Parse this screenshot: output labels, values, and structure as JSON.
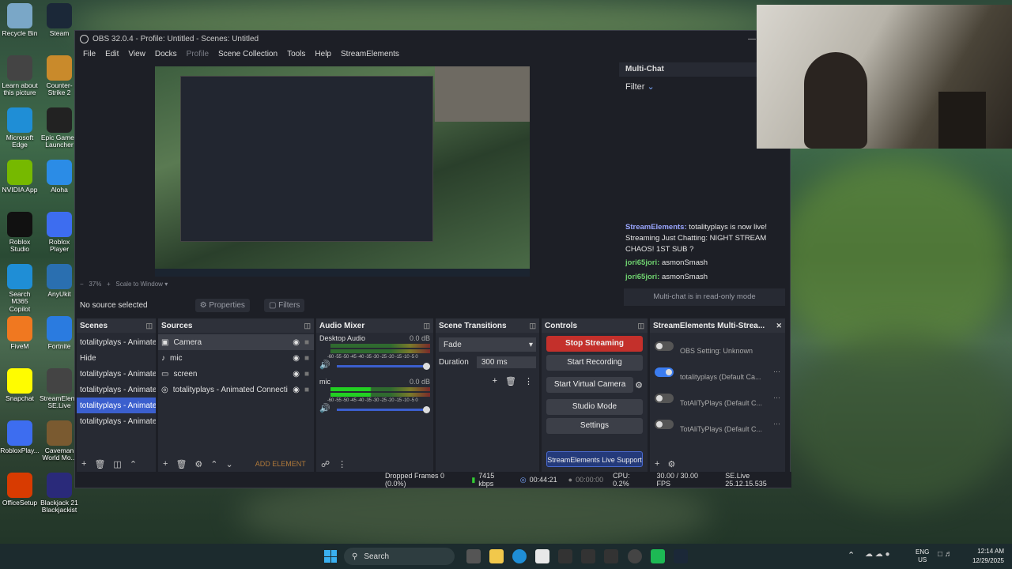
{
  "desktop": {
    "icons": [
      {
        "label": "Recycle Bin",
        "color": "#7aa7c7"
      },
      {
        "label": "Steam",
        "color": "#1b2838"
      },
      {
        "label": "",
        "color": "#ea4335"
      },
      {
        "label": "Learn about this picture",
        "color": "#444"
      },
      {
        "label": "Counter-Strike 2",
        "color": "#c98a2b"
      },
      {
        "label": "Microsoft Edge",
        "color": "#1f8ed6"
      },
      {
        "label": "Epic Games Launcher",
        "color": "#222"
      },
      {
        "label": "NVIDIA App",
        "color": "#76b900"
      },
      {
        "label": "Aloha",
        "color": "#2b8ce6"
      },
      {
        "label": "Roblox Studio",
        "color": "#111"
      },
      {
        "label": "Roblox Player",
        "color": "#3d6df0"
      },
      {
        "label": "Search M365 Copilot",
        "color": "#1f8ed6"
      },
      {
        "label": "AnyUkit",
        "color": "#2a6fb0"
      },
      {
        "label": "FiveM",
        "color": "#f07820"
      },
      {
        "label": "Fortnite",
        "color": "#2a7be0"
      },
      {
        "label": "Snapchat",
        "color": "#fffc00"
      },
      {
        "label": "StreamElements SE.Live",
        "color": "#444"
      },
      {
        "label": "RobloxPlay...",
        "color": "#3d6df0"
      },
      {
        "label": "Caveman World Mo...",
        "color": "#7a5a30"
      },
      {
        "label": "OfficeSetup",
        "color": "#d83b01"
      },
      {
        "label": "Blackjack 21 Blackjackist",
        "color": "#2a2a7a"
      }
    ]
  },
  "obs": {
    "title": "OBS 32.0.4 - Profile: Untitled - Scenes: Untitled",
    "menu": [
      "File",
      "Edit",
      "View",
      "Docks",
      "Profile",
      "Scene Collection",
      "Tools",
      "Help",
      "StreamElements"
    ],
    "zoom_text": "37%",
    "scale_text": "Scale to Window",
    "no_source": "No source selected",
    "properties_label": "Properties",
    "filters_label": "Filters",
    "chat": {
      "title": "Multi-Chat",
      "filter": "Filter",
      "messages": [
        {
          "user": "StreamElements:",
          "text": "totalityplays is now live! Streaming Just Chatting: NIGHT STREAM CHAOS! 1ST SUB ?",
          "type": "u1"
        },
        {
          "user": "jori65jori:",
          "text": "asmonSmash",
          "type": "u2"
        },
        {
          "user": "jori65jori:",
          "text": "asmonSmash",
          "type": "u2"
        }
      ],
      "read_only": "Multi-chat is in read-only mode"
    },
    "scenes": {
      "title": "Scenes",
      "items": [
        "totalityplays - Animated",
        "Hide",
        "totalityplays - Animated",
        "totalityplays - Animated",
        "totalityplays - Animated",
        "totalityplays - Animated"
      ],
      "selected_index": 4
    },
    "sources": {
      "title": "Sources",
      "items": [
        {
          "label": "Camera",
          "icon": "camera-icon"
        },
        {
          "label": "mic",
          "icon": "mic-icon"
        },
        {
          "label": "screen",
          "icon": "monitor-icon"
        },
        {
          "label": "totalityplays - Animated Connectio",
          "icon": "browser-icon"
        }
      ],
      "add_element": "ADD ELEMENT"
    },
    "audio": {
      "title": "Audio Mixer",
      "channels": [
        {
          "name": "Desktop Audio",
          "db": "0.0 dB",
          "active": false
        },
        {
          "name": "mic",
          "db": "0.0 dB",
          "active": true
        }
      ],
      "ticks": "-60 -55 -50 -45 -40 -35 -30 -25 -20 -15 -10 -5 0"
    },
    "transitions": {
      "title": "Scene Transitions",
      "type": "Fade",
      "duration_label": "Duration",
      "duration_value": "300 ms"
    },
    "controls": {
      "title": "Controls",
      "stop_streaming": "Stop Streaming",
      "start_recording": "Start Recording",
      "start_virtual_camera": "Start Virtual Camera",
      "studio_mode": "Studio Mode",
      "settings": "Settings",
      "live_support": "StreamElements Live Support"
    },
    "multistream": {
      "title": "StreamElements Multi-Strea...",
      "items": [
        {
          "label": "OBS Setting: Unknown",
          "on": false
        },
        {
          "label": "totalityplays (Default Ca...",
          "on": true
        },
        {
          "label": "TotAliTyPlays (Default C...",
          "on": false
        },
        {
          "label": "TotAliTyPlays (Default C...",
          "on": false
        }
      ]
    },
    "status": {
      "dropped": "Dropped Frames 0 (0.0%)",
      "bitrate": "7415 kbps",
      "stream_time": "00:44:21",
      "rec_time": "00:00:00",
      "cpu": "CPU: 0.2%",
      "fps": "30.00 / 30.00 FPS",
      "version": "SE.Live 25.12.15.535"
    }
  },
  "taskbar": {
    "search": "Search",
    "lang_top": "ENG",
    "lang_bottom": "US",
    "time": "12:14 AM",
    "date": "12/29/2025"
  }
}
